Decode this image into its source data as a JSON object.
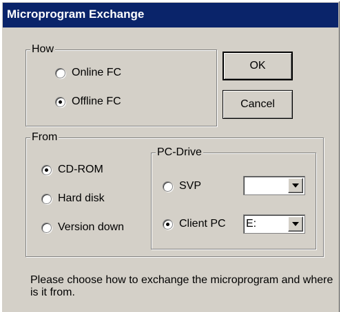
{
  "window": {
    "title": "Microprogram Exchange"
  },
  "how": {
    "legend": "How",
    "options": [
      {
        "label": "Online FC",
        "checked": false
      },
      {
        "label": "Offline FC",
        "checked": true
      }
    ]
  },
  "buttons": {
    "ok": "OK",
    "cancel": "Cancel"
  },
  "from": {
    "legend": "From",
    "options": [
      {
        "label": "CD-ROM",
        "checked": true
      },
      {
        "label": "Hard disk",
        "checked": false
      },
      {
        "label": "Version down",
        "checked": false
      }
    ]
  },
  "pc_drive": {
    "legend": "PC-Drive",
    "svp": {
      "label": "SVP",
      "checked": false,
      "value": ""
    },
    "client_pc": {
      "label": "Client PC",
      "checked": true,
      "value": "E:"
    }
  },
  "message": "Please choose how to exchange the microprogram and where is it from."
}
